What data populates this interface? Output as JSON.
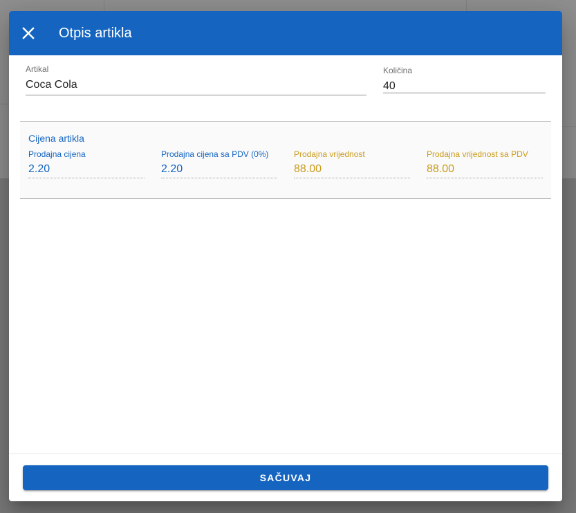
{
  "dialog": {
    "title": "Otpis artikla",
    "close_icon": "close-icon"
  },
  "form": {
    "artikal": {
      "label": "Artikal",
      "value": "Coca Cola"
    },
    "kolicina": {
      "label": "Količina",
      "value": "40"
    }
  },
  "price_section": {
    "title": "Cijena artikla",
    "fields": [
      {
        "label": "Prodajna cijena",
        "value": "2.20",
        "color": "#1565c0"
      },
      {
        "label": "Prodajna cijena sa PDV (0%)",
        "value": "2.20",
        "color": "#1565c0"
      },
      {
        "label": "Prodajna vrijednost",
        "value": "88.00",
        "color": "#c99a1a"
      },
      {
        "label": "Prodajna vrijednost sa PDV",
        "value": "88.00",
        "color": "#c99a1a"
      }
    ]
  },
  "footer": {
    "save_label": "SAČUVAJ"
  },
  "colors": {
    "primary": "#1565c0",
    "accent_gold": "#c99a1a"
  }
}
